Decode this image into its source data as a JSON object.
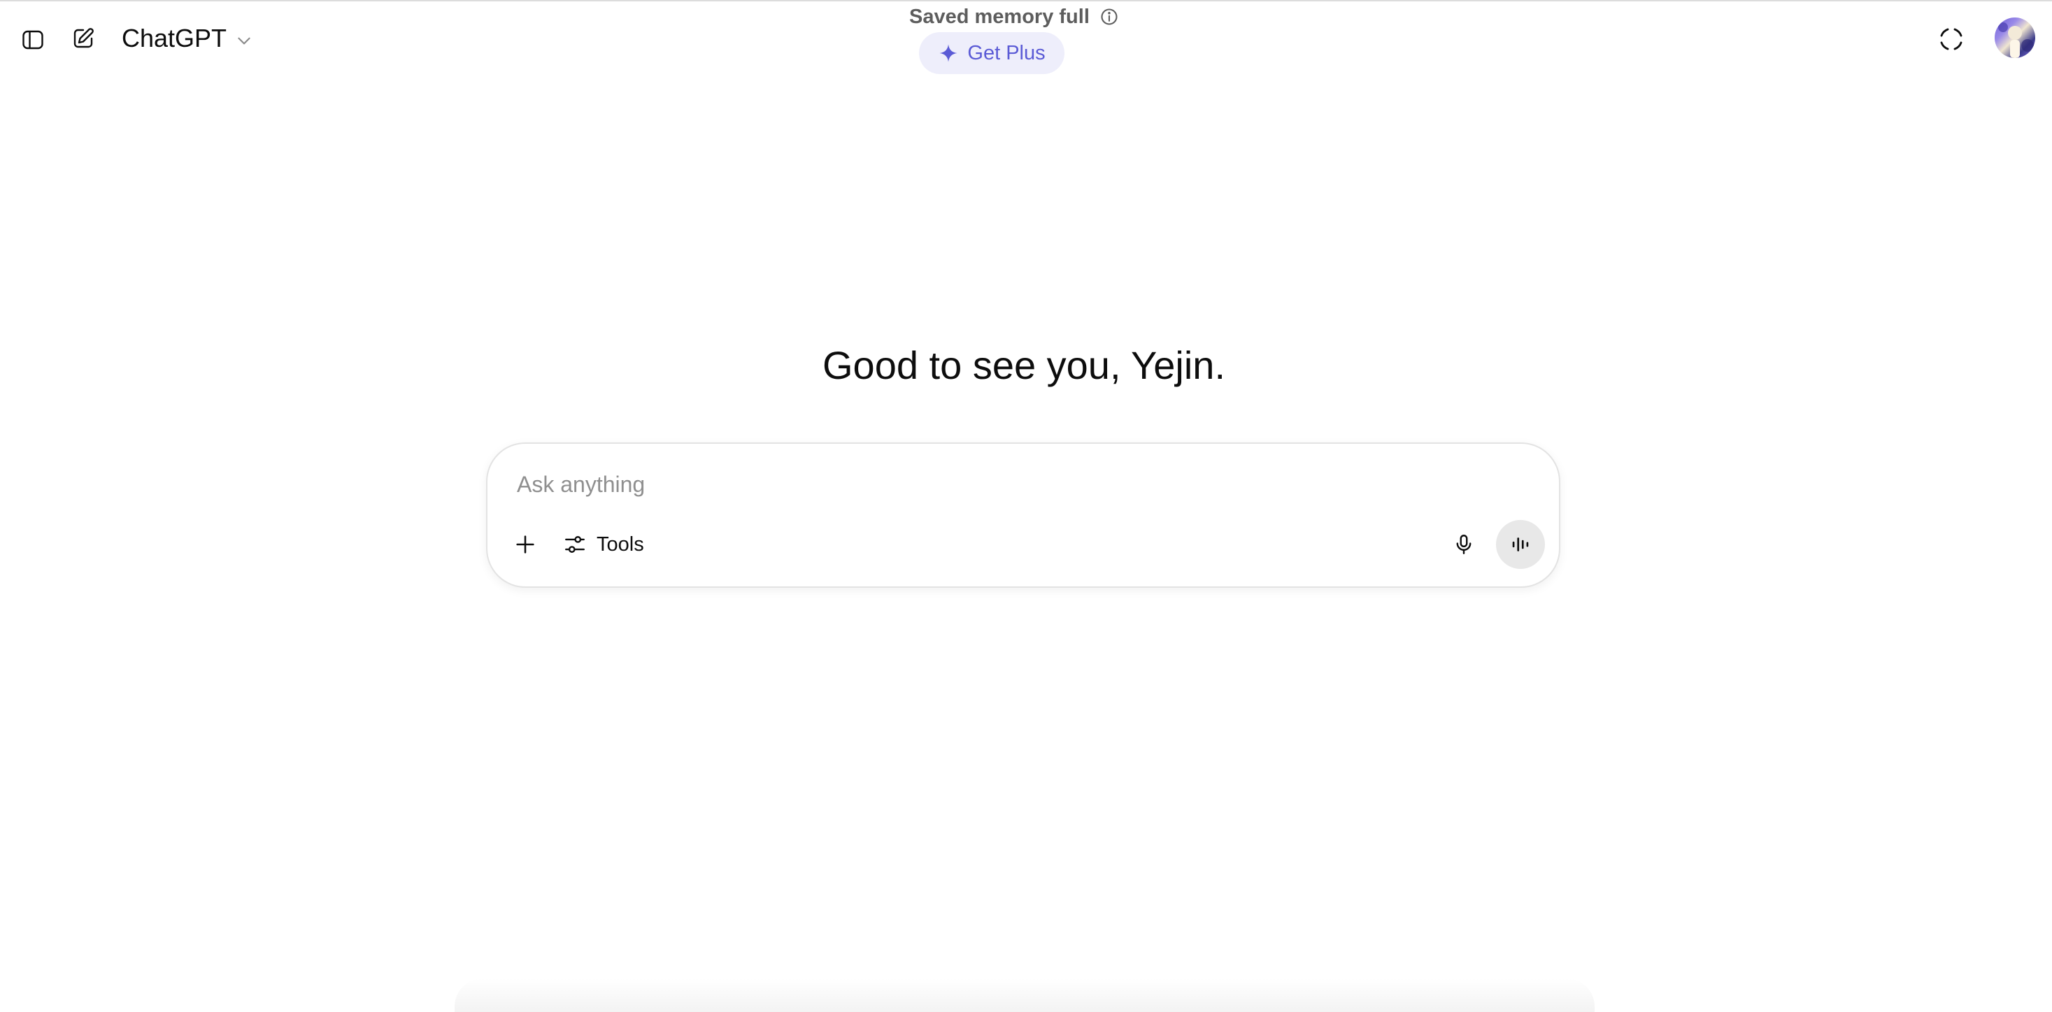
{
  "header": {
    "model_name": "ChatGPT",
    "memory_notice": "Saved memory full",
    "upgrade_label": "Get Plus",
    "icons": {
      "sidebar": "sidebar-toggle-icon",
      "new_chat": "compose-icon",
      "model_menu": "chevron-down-icon",
      "memory_info": "info-icon",
      "upgrade": "sparkle-icon",
      "temporary_chat": "dashed-circle-icon"
    }
  },
  "main": {
    "greeting": "Good to see you, Yejin."
  },
  "composer": {
    "placeholder": "Ask anything",
    "value": "",
    "tools_label": "Tools",
    "icons": {
      "attach": "plus-icon",
      "tools": "sliders-icon",
      "dictate": "microphone-icon",
      "voice_mode": "waveform-icon"
    }
  },
  "colors": {
    "accent": "#5b5bd6",
    "accent_bg": "#eeeefb",
    "text": "#0d0d0d",
    "muted_text": "#5d5d5d",
    "placeholder": "#8f8f8f",
    "composer_border": "#e3e3e3",
    "voice_button_bg": "#e8e8e8"
  }
}
